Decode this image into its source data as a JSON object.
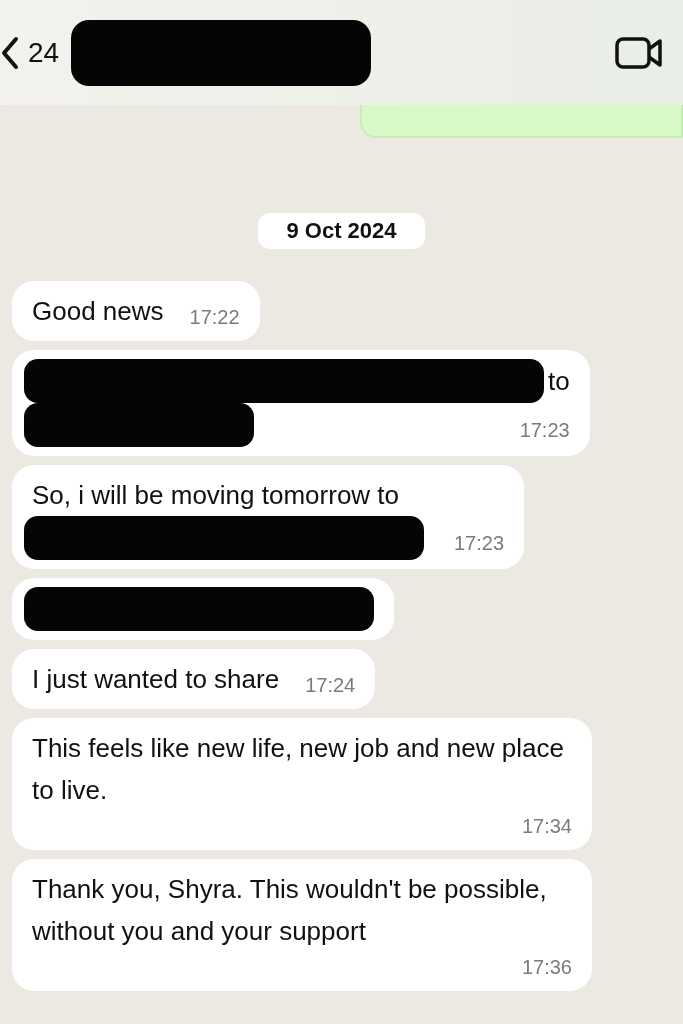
{
  "header": {
    "back_count": "24",
    "name_redacted": true
  },
  "date_divider": "9 Oct 2024",
  "messages": [
    {
      "lines": [
        {
          "text": "Good news",
          "redacted": false
        }
      ],
      "time": "17:22"
    },
    {
      "lines": [
        {
          "text": "to",
          "redacted": true
        },
        {
          "redacted": true
        }
      ],
      "time": "17:23"
    },
    {
      "lines": [
        {
          "text": "So, i will be moving tomorrow to",
          "redacted": false
        },
        {
          "redacted": true
        }
      ],
      "time": "17:23"
    },
    {
      "lines": [
        {
          "redacted": true
        }
      ]
    },
    {
      "lines": [
        {
          "text": "I just wanted to share",
          "redacted": false
        }
      ],
      "time": "17:24"
    },
    {
      "lines": [
        {
          "text": "This feels like new life, new job and new place to live.",
          "redacted": false
        }
      ],
      "time": "17:34"
    },
    {
      "lines": [
        {
          "text": "Thank you, Shyra. This wouldn't be possible, without you and your support",
          "redacted": false
        }
      ],
      "time": "17:36"
    }
  ]
}
